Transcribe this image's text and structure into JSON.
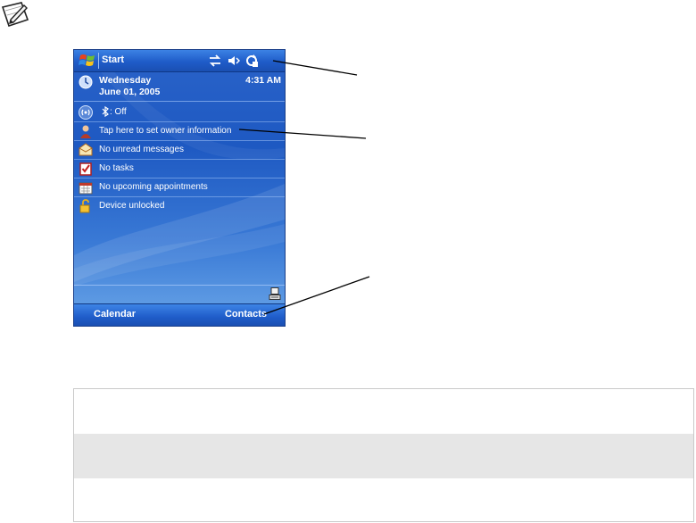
{
  "taskbar": {
    "start_label": "Start"
  },
  "today": {
    "day": "Wednesday",
    "date": "June 01, 2005",
    "time": "4:31 AM",
    "items": [
      {
        "label": ": Off",
        "icon": "wireless-icon"
      },
      {
        "label": "Tap here to set owner information",
        "icon": "owner-icon"
      },
      {
        "label": "No unread messages",
        "icon": "envelope-icon"
      },
      {
        "label": "No tasks",
        "icon": "tasks-icon"
      },
      {
        "label": "No upcoming appointments",
        "icon": "calendar-icon"
      },
      {
        "label": "Device unlocked",
        "icon": "padlock-icon"
      }
    ]
  },
  "softkeys": {
    "left": "Calendar",
    "right": "Contacts"
  },
  "colors": {
    "screen_blue": "#1e59c2",
    "taskbar_blue": "#1f5cc9",
    "table_shade": "#e6e6e6"
  }
}
